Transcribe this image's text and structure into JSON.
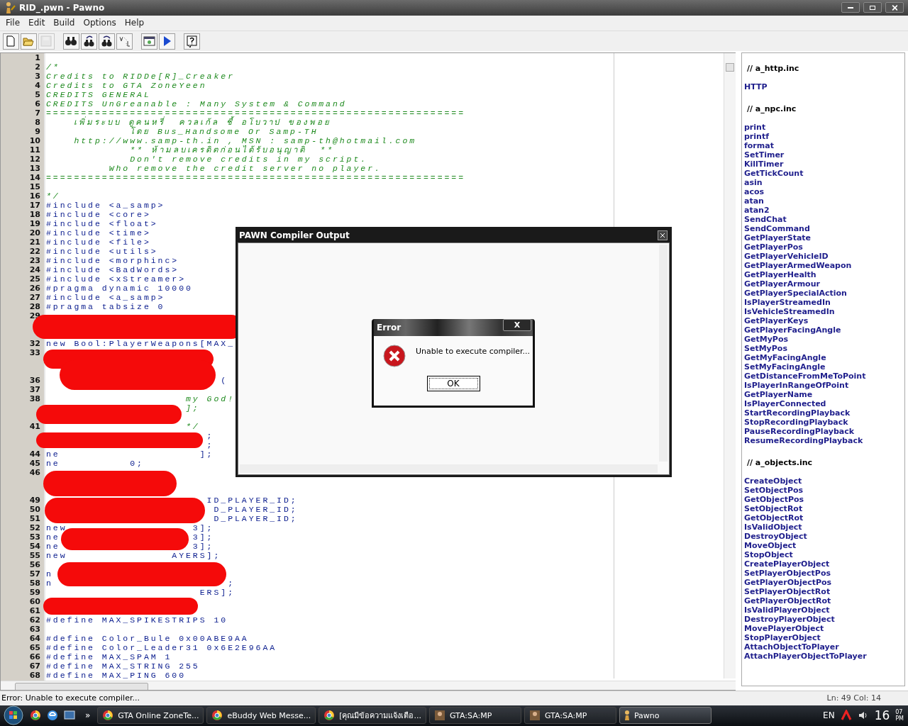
{
  "window": {
    "title": "RID_.pwn - Pawno"
  },
  "menu": [
    "File",
    "Edit",
    "Build",
    "Options",
    "Help"
  ],
  "toolbar": [
    {
      "kind": "new",
      "disabled": false
    },
    {
      "kind": "open",
      "disabled": false
    },
    {
      "kind": "save",
      "disabled": true
    },
    {
      "kind": "find",
      "disabled": false
    },
    {
      "kind": "find-next",
      "disabled": false
    },
    {
      "kind": "replace",
      "disabled": false
    },
    {
      "kind": "goto",
      "disabled": false
    },
    {
      "kind": "compile",
      "disabled": false
    },
    {
      "kind": "run",
      "disabled": false
    },
    {
      "kind": "help",
      "disabled": false
    }
  ],
  "editor": {
    "lines": [
      {
        "number": "1",
        "kind": "code"
      },
      {
        "number": "2",
        "text": "/*",
        "kind": "comment"
      },
      {
        "number": "3",
        "text": "Credits to RIDDe[R]_Creaker",
        "kind": "comment"
      },
      {
        "number": "4",
        "text": "Credits to GTA ZoneYeen",
        "kind": "comment"
      },
      {
        "number": "5",
        "text": "CREDITS GENERAL",
        "kind": "comment"
      },
      {
        "number": "6",
        "text": "CREDITS UnGreanable : Many System & Command",
        "kind": "comment"
      },
      {
        "number": "7",
        "text": "============================================================",
        "kind": "comment"
      },
      {
        "number": "8",
        "text": "    เพิ่มระบบ ดูคนหรี่  ควลเก้ล ชี้ อโบวาป ของพอย",
        "kind": "comment"
      },
      {
        "number": "9",
        "text": "            โดย Bus_Handsome Or Samp-TH",
        "kind": "comment"
      },
      {
        "number": "10",
        "text": "    http://www.samp-th.in , MSN : samp-th@hotmail.com",
        "kind": "comment"
      },
      {
        "number": "11",
        "text": "            ** ห้ามลบเครดิตก่อนได้รับอนุญาติ  **",
        "kind": "comment"
      },
      {
        "number": "12",
        "text": "            Don't remove credits in my script.",
        "kind": "comment"
      },
      {
        "number": "13",
        "text": "         Who remove the credit server no player.",
        "kind": "comment"
      },
      {
        "number": "14",
        "text": "============================================================",
        "kind": "comment"
      },
      {
        "number": "15",
        "kind": "code"
      },
      {
        "number": "16",
        "text": "*/",
        "kind": "comment"
      },
      {
        "number": "17",
        "text": "#include <a_samp>",
        "kind": "code"
      },
      {
        "number": "18",
        "text": "#include <core>",
        "kind": "code"
      },
      {
        "number": "19",
        "text": "#include <float>",
        "kind": "code"
      },
      {
        "number": "20",
        "text": "#include <time>",
        "kind": "code"
      },
      {
        "number": "21",
        "text": "#include <file>",
        "kind": "code"
      },
      {
        "number": "22",
        "text": "#include <utils>",
        "kind": "code"
      },
      {
        "number": "23",
        "text": "#include <morphinc>",
        "kind": "code"
      },
      {
        "number": "24",
        "text": "#include <BadWords>",
        "kind": "code"
      },
      {
        "number": "25",
        "text": "#include <xStreamer>",
        "kind": "code"
      },
      {
        "number": "26",
        "text": "#pragma dynamic 10000",
        "kind": "code"
      },
      {
        "number": "27",
        "text": "#include <a_samp>",
        "kind": "code"
      },
      {
        "number": "28",
        "text": "#pragma tabsize 0",
        "kind": "code"
      },
      {
        "number": "29",
        "kind": "code"
      },
      {
        "kind": "code"
      },
      {
        "kind": "code"
      },
      {
        "number": "32",
        "text": "new Bool:PlayerWeapons[MAX_",
        "kind": "code"
      },
      {
        "number": "33",
        "kind": "code"
      },
      {
        "kind": "code"
      },
      {
        "kind": "code"
      },
      {
        "number": "36",
        "text": "                         (",
        "kind": "code"
      },
      {
        "number": "37",
        "kind": "code"
      },
      {
        "number": "38",
        "text": "                    my God!",
        "kind": "comment"
      },
      {
        "text": "                    ];",
        "kind": "comment"
      },
      {
        "kind": "code"
      },
      {
        "number": "41",
        "text": "                    */",
        "kind": "comment"
      },
      {
        "text": "                       ;",
        "kind": "code"
      },
      {
        "text": "                       ;",
        "kind": "code"
      },
      {
        "number": "44",
        "text": "ne                    ];",
        "kind": "code"
      },
      {
        "number": "45",
        "text": "ne          0;",
        "kind": "code"
      },
      {
        "number": "46",
        "kind": "code"
      },
      {
        "kind": "code"
      },
      {
        "kind": "code"
      },
      {
        "number": "49",
        "text": "                       ID_PLAYER_ID;",
        "kind": "code"
      },
      {
        "number": "50",
        "text": "                        D_PLAYER_ID;",
        "kind": "code"
      },
      {
        "number": "51",
        "text": "                        D_PLAYER_ID;",
        "kind": "code"
      },
      {
        "number": "52",
        "text": "new                  3];",
        "kind": "code"
      },
      {
        "number": "53",
        "text": "ne                   3];",
        "kind": "code"
      },
      {
        "number": "54",
        "text": "ne                   3];",
        "kind": "code"
      },
      {
        "number": "55",
        "text": "new               AYERS];",
        "kind": "code"
      },
      {
        "number": "56",
        "kind": "code"
      },
      {
        "number": "57",
        "text": "n",
        "kind": "code"
      },
      {
        "number": "58",
        "text": "n                         ;",
        "kind": "code"
      },
      {
        "number": "59",
        "text": "                      ERS];",
        "kind": "code"
      },
      {
        "number": "60",
        "kind": "code"
      },
      {
        "number": "61",
        "kind": "code"
      },
      {
        "number": "62",
        "text": "#define MAX_SPIKESTRIPS 10",
        "kind": "code"
      },
      {
        "number": "63",
        "kind": "code"
      },
      {
        "number": "64",
        "text": "#define Color_Bule 0x00ABE9AA",
        "kind": "code"
      },
      {
        "number": "65",
        "text": "#define Color_Leader31 0x6E2E96AA",
        "kind": "code"
      },
      {
        "number": "66",
        "text": "#define MAX_SPAM 1",
        "kind": "code"
      },
      {
        "number": "67",
        "text": "#define MAX_STRING 255",
        "kind": "code"
      },
      {
        "number": "68",
        "text": "#define MAX_PING 600",
        "kind": "code"
      }
    ]
  },
  "functions": [
    {
      "header": "// a_http.inc",
      "items": [
        "HTTP"
      ]
    },
    {
      "header": "// a_npc.inc",
      "items": [
        "print",
        "printf",
        "format",
        "SetTimer",
        "KillTimer",
        "GetTickCount",
        "asin",
        "acos",
        "atan",
        "atan2",
        "SendChat",
        "SendCommand",
        "GetPlayerState",
        "GetPlayerPos",
        "GetPlayerVehicleID",
        "GetPlayerArmedWeapon",
        "GetPlayerHealth",
        "GetPlayerArmour",
        "GetPlayerSpecialAction",
        "IsPlayerStreamedIn",
        "IsVehicleStreamedIn",
        "GetPlayerKeys",
        "GetPlayerFacingAngle",
        "GetMyPos",
        "SetMyPos",
        "GetMyFacingAngle",
        "SetMyFacingAngle",
        "GetDistanceFromMeToPoint",
        "IsPlayerInRangeOfPoint",
        "GetPlayerName",
        "IsPlayerConnected",
        "StartRecordingPlayback",
        "StopRecordingPlayback",
        "PauseRecordingPlayback",
        "ResumeRecordingPlayback"
      ]
    },
    {
      "header": "// a_objects.inc",
      "items": [
        "CreateObject",
        "SetObjectPos",
        "GetObjectPos",
        "SetObjectRot",
        "GetObjectRot",
        "IsValidObject",
        "DestroyObject",
        "MoveObject",
        "StopObject",
        "CreatePlayerObject",
        "SetPlayerObjectPos",
        "GetPlayerObjectPos",
        "SetPlayerObjectRot",
        "GetPlayerObjectRot",
        "IsValidPlayerObject",
        "DestroyPlayerObject",
        "MovePlayerObject",
        "StopPlayerObject",
        "AttachObjectToPlayer",
        "AttachPlayerObjectToPlayer"
      ]
    }
  ],
  "compiler_output": {
    "title": "PAWN Compiler Output"
  },
  "error_dialog": {
    "title": "Error",
    "close": "X",
    "message": "Unable to execute compiler...",
    "button": "OK"
  },
  "status_bar": {
    "message": "Error: Unable to execute compiler...",
    "position": "Ln: 49  Col: 14"
  },
  "taskbar": {
    "quick_more": "»",
    "tasks": [
      {
        "label": "GTA Online ZoneTe...",
        "kind": "browser",
        "selected": false
      },
      {
        "label": "eBuddy Web Messe...",
        "kind": "browser",
        "selected": false
      },
      {
        "label": "[คุณมีข้อความแจ้งเตือ...",
        "kind": "browser",
        "selected": false
      },
      {
        "label": "GTA:SA:MP",
        "kind": "game",
        "selected": false
      },
      {
        "label": "GTA:SA:MP",
        "kind": "game",
        "selected": false
      },
      {
        "label": "Pawno",
        "kind": "pawno",
        "selected": true
      }
    ],
    "language": "EN",
    "clock_hour": "16",
    "clock_minute": "07",
    "clock_ampm": "PM"
  }
}
